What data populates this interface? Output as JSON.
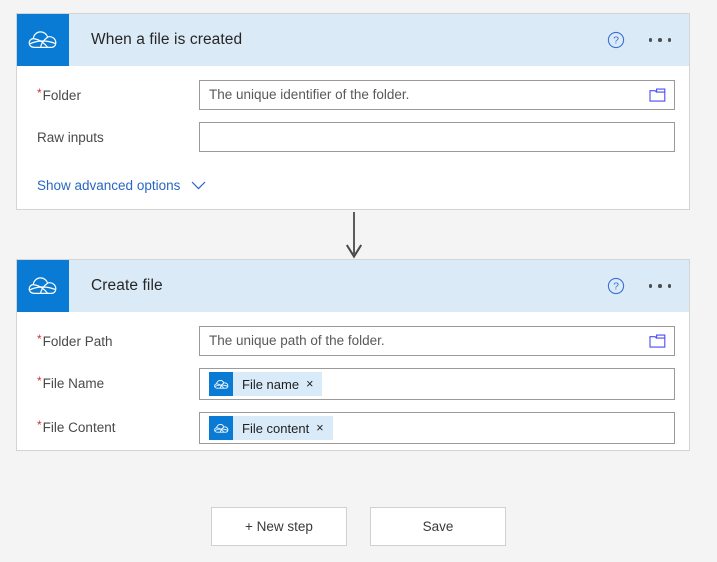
{
  "theme": {
    "page_bg": "#f4f4f4",
    "card_bg": "#ffffff",
    "header_bg": "#dbeaf7",
    "brand_blue": "#0a7bd4",
    "link_blue": "#2866c4",
    "required_red": "#d13438",
    "chip_bg": "#d9eaf8"
  },
  "trigger_card": {
    "logo_icon": "onedrive-cloud-icon",
    "title": "When a file is created",
    "help_icon": "help-circle-icon",
    "menu_icon": "ellipsis-icon",
    "rows": [
      {
        "label": "Folder",
        "required": true,
        "value": "The unique identifier of the folder.",
        "picker_icon": "folder-picker-icon",
        "has_picker": true
      },
      {
        "label": "Raw inputs",
        "required": false,
        "value": "",
        "has_picker": false
      }
    ],
    "advanced_link": "Show advanced options",
    "advanced_chevron_icon": "chevron-down-icon"
  },
  "connector": {
    "icon": "down-arrow-icon"
  },
  "action_card": {
    "logo_icon": "onedrive-cloud-icon",
    "title": "Create file",
    "help_icon": "help-circle-icon",
    "menu_icon": "ellipsis-icon",
    "rows": [
      {
        "label": "Folder Path",
        "required": true,
        "value": "The unique path of the folder.",
        "picker_icon": "folder-picker-icon",
        "has_picker": true,
        "kind": "text"
      },
      {
        "label": "File Name",
        "required": true,
        "kind": "token",
        "token": {
          "logo_icon": "onedrive-cloud-icon",
          "label": "File name",
          "close_icon": "close-icon",
          "close_glyph": "×"
        }
      },
      {
        "label": "File Content",
        "required": true,
        "kind": "token",
        "token": {
          "logo_icon": "onedrive-cloud-icon",
          "label": "File content",
          "close_icon": "close-icon",
          "close_glyph": "×"
        }
      }
    ]
  },
  "footer": {
    "new_step_label": "+ New step",
    "save_label": "Save"
  }
}
